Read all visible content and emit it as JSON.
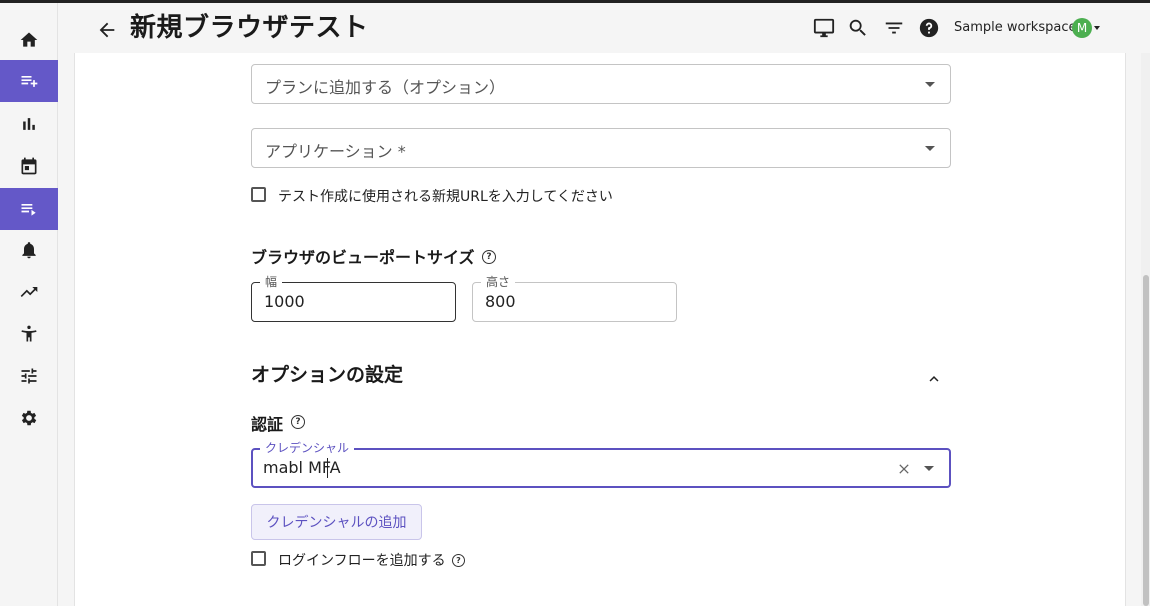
{
  "header": {
    "title": "新規ブラウザテスト",
    "workspace": "Sample workspace",
    "avatar_initial": "M"
  },
  "sidebar": {
    "items": [
      {
        "icon": "home-icon"
      },
      {
        "icon": "playlist-add-icon",
        "active": true
      },
      {
        "icon": "bar-chart-icon"
      },
      {
        "icon": "calendar-icon"
      },
      {
        "icon": "playlist-play-icon",
        "active": true
      },
      {
        "icon": "bell-icon"
      },
      {
        "icon": "trending-up-icon"
      },
      {
        "icon": "accessibility-icon"
      },
      {
        "icon": "tune-icon"
      },
      {
        "icon": "gear-icon"
      }
    ]
  },
  "form": {
    "plan_placeholder": "プランに追加する（オプション）",
    "application_placeholder": "アプリケーション *",
    "new_url_checkbox_label": "テスト作成に使用される新規URLを入力してください",
    "viewport_title": "ブラウザのビューポートサイズ",
    "width_label": "幅",
    "width_value": "1000",
    "height_label": "高さ",
    "height_value": "800",
    "options_title": "オプションの設定",
    "auth_title": "認証",
    "credential_label": "クレデンシャル",
    "credential_value": "mabl MFA",
    "add_credential_button": "クレデンシャルの追加",
    "login_flow_checkbox_label": "ログインフローを追加する"
  },
  "colors": {
    "accent": "#6458c8",
    "focus": "#5c51c0"
  }
}
